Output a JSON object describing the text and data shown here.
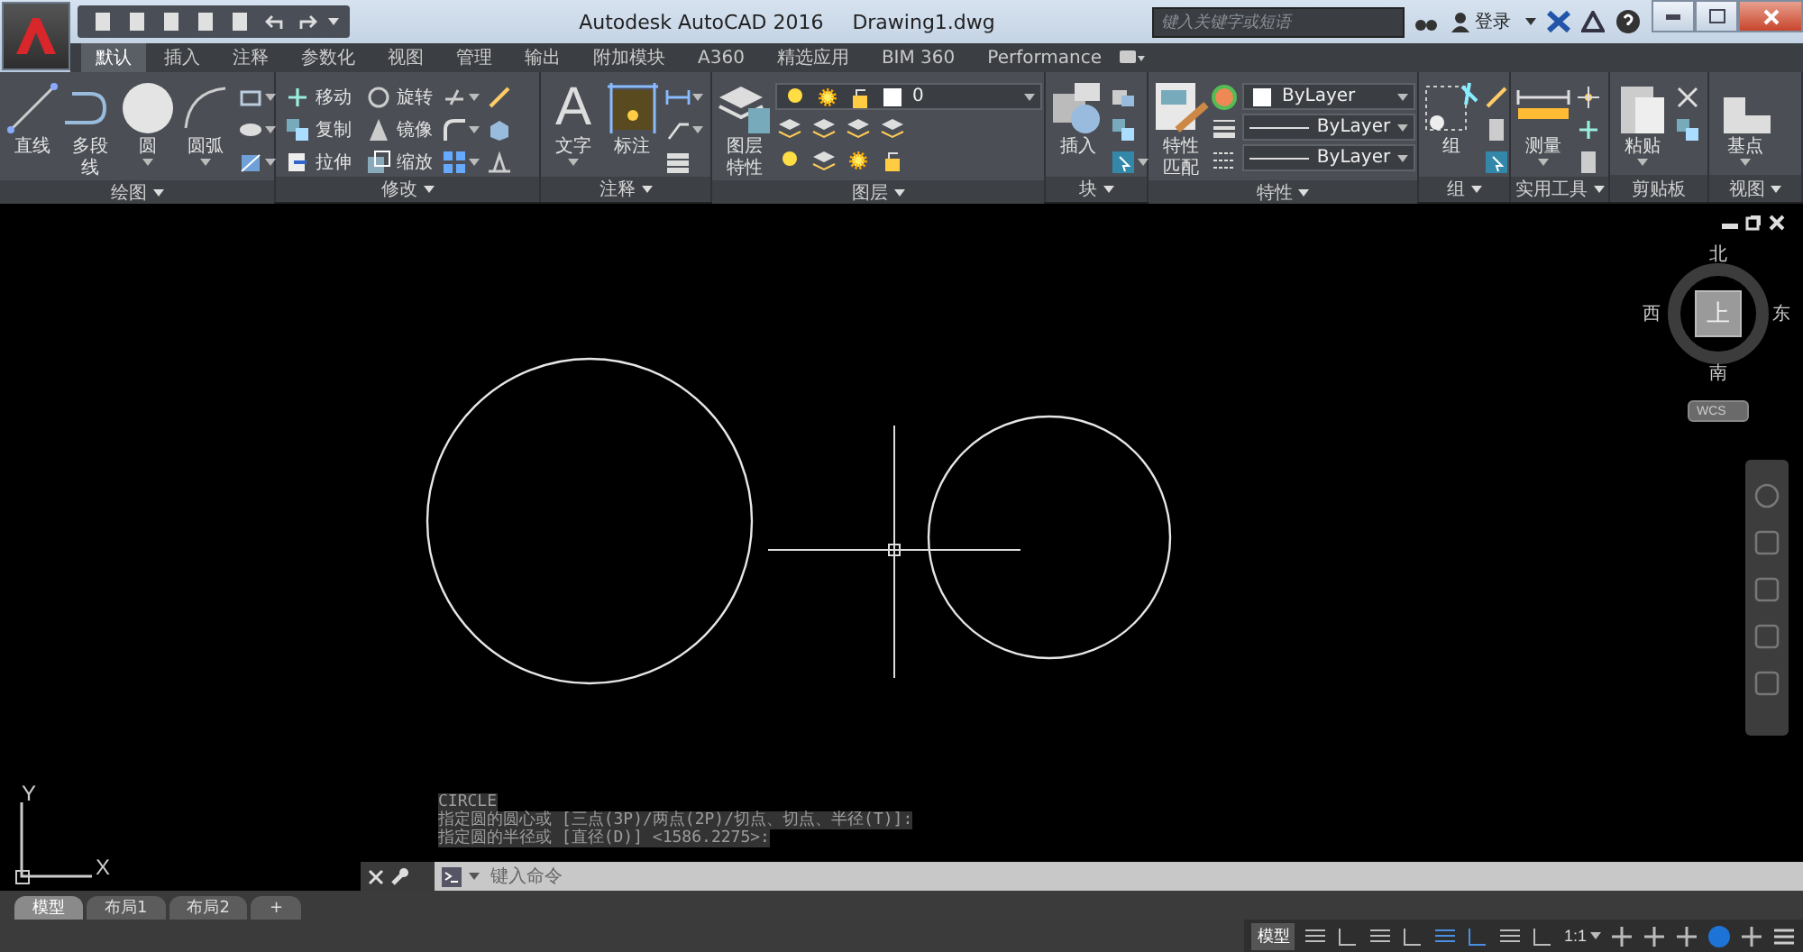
{
  "window": {
    "title": "Autodesk AutoCAD 2016",
    "document": "Drawing1.dwg"
  },
  "search": {
    "placeholder": "键入关键字或短语"
  },
  "sign_in": "登录",
  "ribbon_tabs": [
    {
      "label": "默认",
      "selected": true
    },
    {
      "label": "插入",
      "selected": false
    },
    {
      "label": "注释",
      "selected": false
    },
    {
      "label": "参数化",
      "selected": false
    },
    {
      "label": "视图",
      "selected": false
    },
    {
      "label": "管理",
      "selected": false
    },
    {
      "label": "输出",
      "selected": false
    },
    {
      "label": "附加模块",
      "selected": false
    },
    {
      "label": "A360",
      "selected": false
    },
    {
      "label": "精选应用",
      "selected": false
    },
    {
      "label": "BIM 360",
      "selected": false
    },
    {
      "label": "Performance",
      "selected": false
    }
  ],
  "panels": [
    {
      "title": "绘图",
      "menu": true,
      "large": [
        {
          "label": "直线",
          "menu": false
        },
        {
          "label": "多段线",
          "menu": false
        },
        {
          "label": "圆",
          "menu": true
        },
        {
          "label": "圆弧",
          "menu": true
        }
      ]
    },
    {
      "title": "修改",
      "menu": true,
      "small": [
        "移动",
        "旋转",
        "复制",
        "镜像",
        "拉伸",
        "缩放"
      ]
    },
    {
      "title": "注释",
      "menu": true,
      "large": [
        {
          "label": "文字",
          "menu": true,
          "glyph": "A"
        },
        {
          "label": "标注",
          "menu": false
        }
      ]
    },
    {
      "title": "图层",
      "menu": true,
      "large": [
        {
          "label": "图层特性",
          "menu": false
        }
      ],
      "dropdowns": [
        "0"
      ]
    },
    {
      "title": "块",
      "menu": true,
      "large": [
        {
          "label": "插入",
          "menu": false
        }
      ]
    },
    {
      "title": "特性",
      "menu": true,
      "large": [
        {
          "label": "特性匹配",
          "menu": false
        }
      ],
      "dropdowns": [
        "ByLayer",
        "ByLayer",
        "ByLayer"
      ]
    },
    {
      "title": "组",
      "menu": true,
      "large": [
        {
          "label": "组",
          "menu": false
        }
      ]
    },
    {
      "title": "实用工具",
      "menu": true,
      "large": [
        {
          "label": "测量",
          "menu": true
        }
      ]
    },
    {
      "title": "剪贴板",
      "menu": false,
      "large": [
        {
          "label": "粘贴",
          "menu": true
        }
      ]
    },
    {
      "title": "视图",
      "menu": true,
      "large": [
        {
          "label": "基点",
          "menu": true
        }
      ]
    }
  ],
  "viewcube": {
    "north": "北",
    "south": "南",
    "east": "东",
    "west": "西",
    "face": "上",
    "ucs": "WCS"
  },
  "ucs_icon": {
    "x": "X",
    "y": "Y"
  },
  "command_history": [
    "CIRCLE",
    "指定圆的圆心或 [三点(3P)/两点(2P)/切点、切点、半径(T)]:",
    "指定圆的半径或 [直径(D)] <1586.2275>:"
  ],
  "command_line": {
    "placeholder": "键入命令"
  },
  "layout_tabs": [
    {
      "label": "模型",
      "selected": true
    },
    {
      "label": "布局1",
      "selected": false
    },
    {
      "label": "布局2",
      "selected": false
    }
  ],
  "add_layout": "+",
  "status_bar": {
    "space": "模型",
    "scale": "1:1"
  }
}
